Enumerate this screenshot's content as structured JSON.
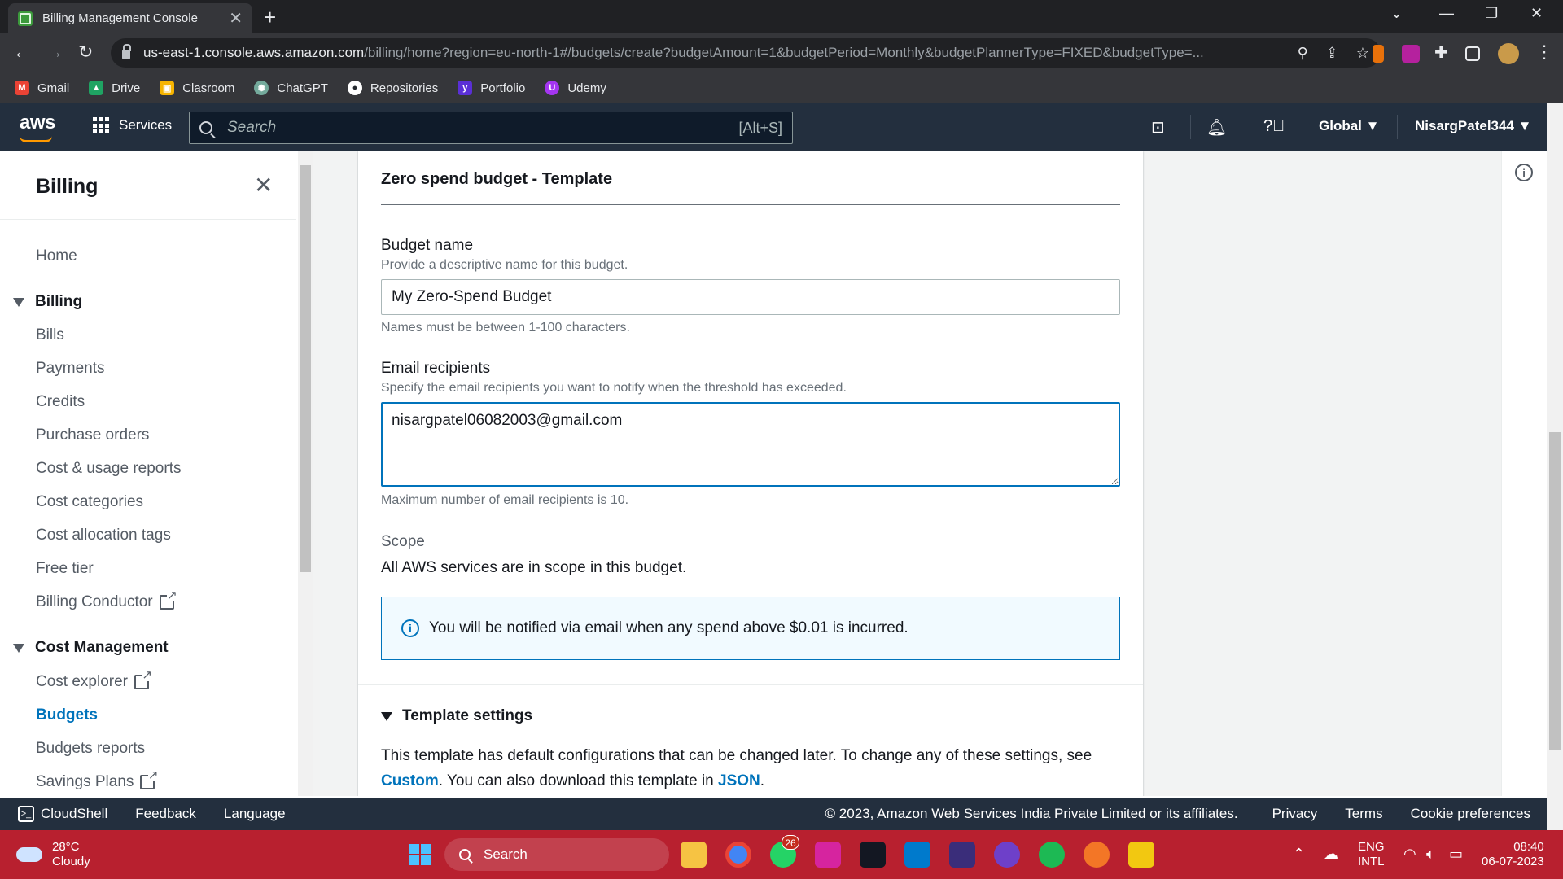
{
  "browser": {
    "tab_title": "Billing Management Console",
    "url_host": "us-east-1.console.aws.amazon.com",
    "url_path": "/billing/home?region=eu-north-1#/budgets/create?budgetAmount=1&budgetPeriod=Monthly&budgetPlannerType=FIXED&budgetType=...",
    "bookmarks": [
      {
        "label": "Gmail",
        "color": "#ea4335"
      },
      {
        "label": "Drive",
        "color": "#1fa463"
      },
      {
        "label": "Clasroom",
        "color": "#f6b400"
      },
      {
        "label": "ChatGPT",
        "color": "#74aa9c"
      },
      {
        "label": "Repositories",
        "color": "#24292f"
      },
      {
        "label": "Portfolio",
        "color": "#5a2fd6"
      },
      {
        "label": "Udemy",
        "color": "#a435f0"
      }
    ]
  },
  "aws_header": {
    "logo": "aws",
    "services_label": "Services",
    "search_placeholder": "Search",
    "search_hint": "[Alt+S]",
    "region_label": "Global",
    "account_label": "NisargPatel344",
    "brand_color": "#232f3e",
    "accent_color": "#ff9900"
  },
  "sidebar": {
    "title": "Billing",
    "items": [
      {
        "label": "Home"
      },
      {
        "label": "Billing",
        "section": true
      },
      {
        "label": "Bills"
      },
      {
        "label": "Payments"
      },
      {
        "label": "Credits"
      },
      {
        "label": "Purchase orders"
      },
      {
        "label": "Cost & usage reports"
      },
      {
        "label": "Cost categories"
      },
      {
        "label": "Cost allocation tags"
      },
      {
        "label": "Free tier"
      },
      {
        "label": "Billing Conductor",
        "external": true
      },
      {
        "label": "Cost Management",
        "section": true
      },
      {
        "label": "Cost explorer",
        "external": true
      },
      {
        "label": "Budgets",
        "active": true
      },
      {
        "label": "Budgets reports"
      },
      {
        "label": "Savings Plans",
        "external": true
      }
    ]
  },
  "form": {
    "title": "Zero spend budget - Template",
    "budget_name": {
      "label": "Budget name",
      "description": "Provide a descriptive name for this budget.",
      "value": "My Zero-Spend Budget",
      "constraint": "Names must be between 1-100 characters."
    },
    "email_recipients": {
      "label": "Email recipients",
      "description": "Specify the email recipients you want to notify when the threshold has exceeded.",
      "value": "nisargpatel06082003@gmail.com",
      "constraint": "Maximum number of email recipients is 10."
    },
    "scope": {
      "label": "Scope",
      "value": "All AWS services are in scope in this budget."
    },
    "alert_text": "You will be notified via email when any spend above $0.01 is incurred.",
    "template_settings": {
      "heading": "Template settings",
      "text_part1": "This template has default configurations that can be changed later. To change any of these settings, see",
      "link_custom": "Custom",
      "text_part2": ". You can also download this template in",
      "link_json": "JSON",
      "text_part3": "."
    }
  },
  "footer": {
    "cloudshell": "CloudShell",
    "feedback": "Feedback",
    "language": "Language",
    "copyright": "© 2023, Amazon Web Services India Private Limited or its affiliates.",
    "privacy": "Privacy",
    "terms": "Terms",
    "cookie": "Cookie preferences"
  },
  "taskbar": {
    "temperature": "28°C",
    "weather": "Cloudy",
    "search_label": "Search",
    "whatsapp_badge": "26",
    "lang_top": "ENG",
    "lang_bottom": "INTL",
    "time": "08:40",
    "date": "06-07-2023"
  }
}
